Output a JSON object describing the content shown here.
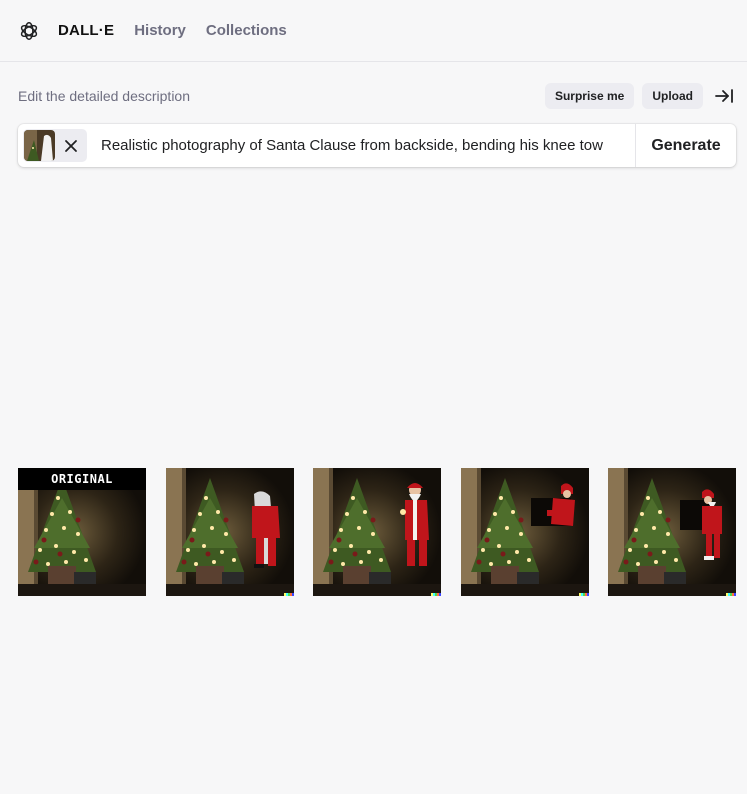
{
  "header": {
    "brand": "DALL·E",
    "nav": [
      "History",
      "Collections"
    ]
  },
  "editor": {
    "description_label": "Edit the detailed description",
    "surprise_label": "Surprise me",
    "upload_label": "Upload",
    "prompt_value": "Realistic photography of Santa Clause from backside, bending his knee tow",
    "generate_label": "Generate"
  },
  "gallery": {
    "original_label": "ORIGINAL",
    "tiles": [
      {
        "name": "original-image",
        "variant": "original"
      },
      {
        "name": "generated-image-1",
        "variant": "santa-back"
      },
      {
        "name": "generated-image-2",
        "variant": "santa-front"
      },
      {
        "name": "generated-image-3",
        "variant": "santa-bent"
      },
      {
        "name": "generated-image-4",
        "variant": "santa-side"
      }
    ]
  },
  "colors": {
    "background": "#f7f7f8",
    "santa_red": "#c0151b",
    "tree_green": "#3e5a22",
    "lights": "#ffe9a8"
  }
}
